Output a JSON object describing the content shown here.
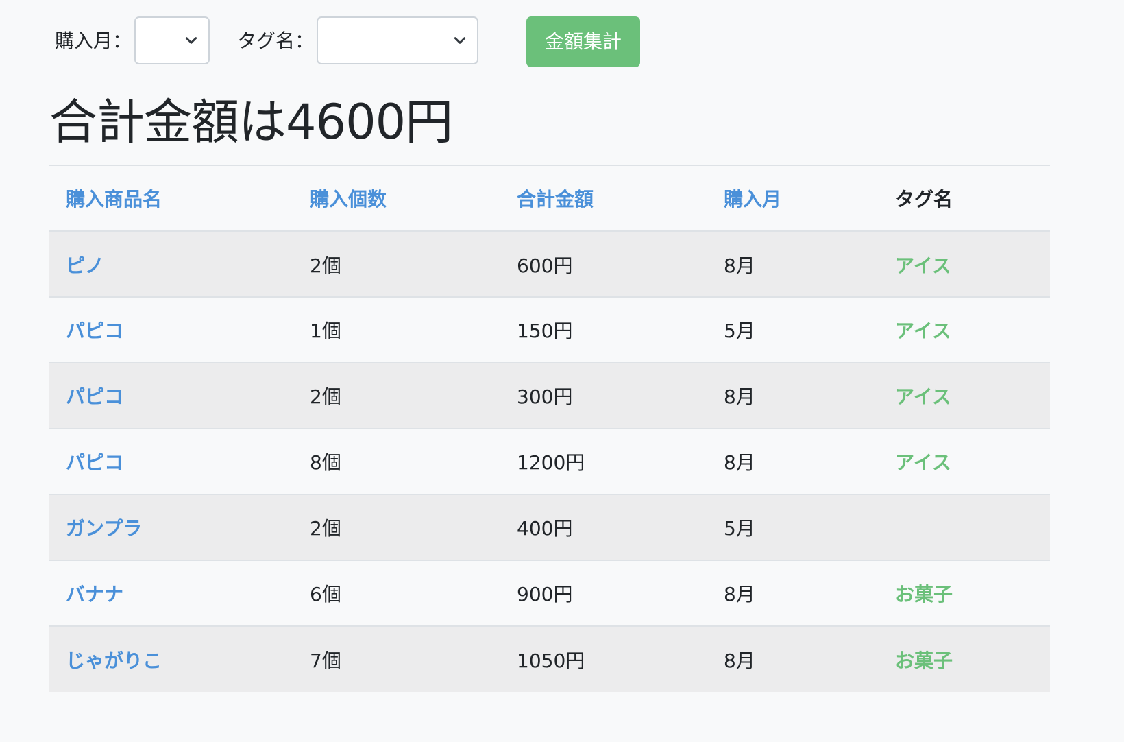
{
  "filters": {
    "month_label": "購入月：",
    "month_value": "",
    "tag_label": "タグ名：",
    "tag_value": "",
    "submit_label": "金額集計"
  },
  "summary": {
    "title": "合計金額は4600円"
  },
  "table": {
    "headers": {
      "name": "購入商品名",
      "quantity": "購入個数",
      "amount": "合計金額",
      "month": "購入月",
      "tag": "タグ名"
    },
    "rows": [
      {
        "name": "ピノ",
        "quantity": "2個",
        "amount": "600円",
        "month": "8月",
        "tag": "アイス"
      },
      {
        "name": "パピコ",
        "quantity": "1個",
        "amount": "150円",
        "month": "5月",
        "tag": "アイス"
      },
      {
        "name": "パピコ",
        "quantity": "2個",
        "amount": "300円",
        "month": "8月",
        "tag": "アイス"
      },
      {
        "name": "パピコ",
        "quantity": "8個",
        "amount": "1200円",
        "month": "8月",
        "tag": "アイス"
      },
      {
        "name": "ガンプラ",
        "quantity": "2個",
        "amount": "400円",
        "month": "5月",
        "tag": ""
      },
      {
        "name": "バナナ",
        "quantity": "6個",
        "amount": "900円",
        "month": "8月",
        "tag": "お菓子"
      },
      {
        "name": "じゃがりこ",
        "quantity": "7個",
        "amount": "1050円",
        "month": "8月",
        "tag": "お菓子"
      }
    ]
  },
  "colors": {
    "link": "#4a90d9",
    "tag": "#6bc07a",
    "button": "#6bc07a",
    "stripe": "#ececed",
    "page_background": "#f8f9fa"
  },
  "icons": {
    "select_arrow": "chevron-down-icon"
  }
}
